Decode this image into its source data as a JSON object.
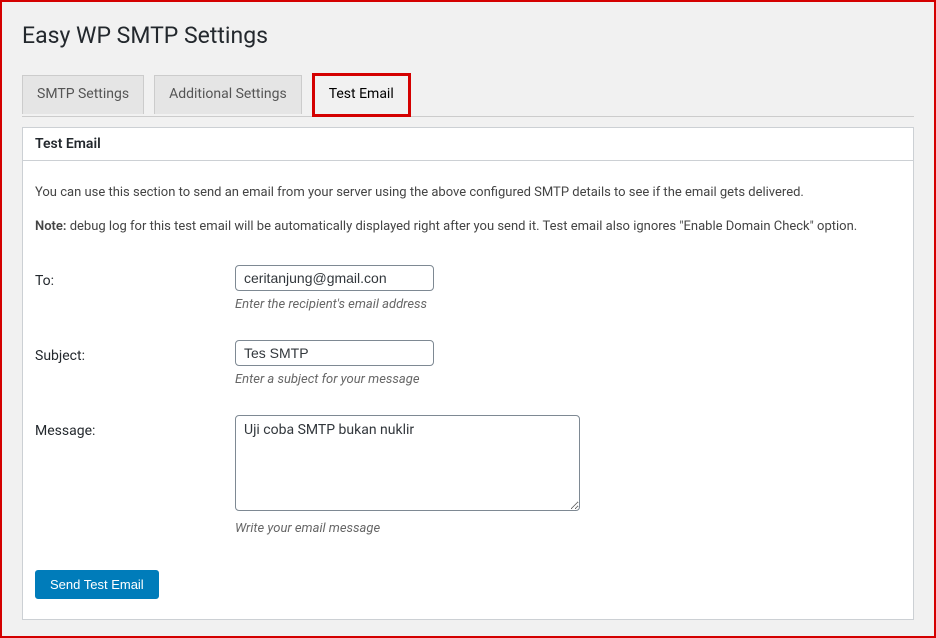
{
  "page_title": "Easy WP SMTP Settings",
  "tabs": [
    {
      "label": "SMTP Settings"
    },
    {
      "label": "Additional Settings"
    },
    {
      "label": "Test Email"
    }
  ],
  "section": {
    "header": "Test Email",
    "intro": "You can use this section to send an email from your server using the above configured SMTP details to see if the email gets delivered.",
    "note_label": "Note:",
    "note_text": " debug log for this test email will be automatically displayed right after you send it. Test email also ignores \"Enable Domain Check\" option."
  },
  "fields": {
    "to": {
      "label": "To:",
      "value": "ceritanjung@gmail.con",
      "description": "Enter the recipient's email address"
    },
    "subject": {
      "label": "Subject:",
      "value": "Tes SMTP",
      "description": "Enter a subject for your message"
    },
    "message": {
      "label": "Message:",
      "value": "Uji coba SMTP bukan nuklir",
      "description": "Write your email message"
    }
  },
  "submit_label": "Send Test Email"
}
